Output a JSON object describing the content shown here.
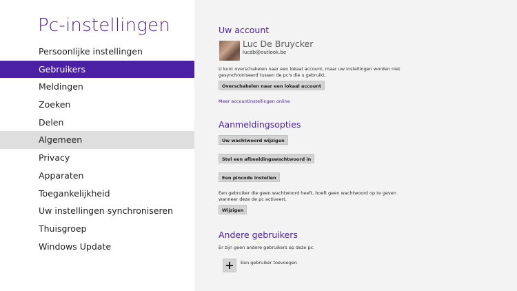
{
  "app": {
    "title": "Pc-instellingen"
  },
  "nav": {
    "items": [
      {
        "label": "Persoonlijke instellingen",
        "name": "nav-item-persoonlijke-instellingen",
        "state": "normal"
      },
      {
        "label": "Gebruikers",
        "name": "nav-item-gebruikers",
        "state": "selected"
      },
      {
        "label": "Meldingen",
        "name": "nav-item-meldingen",
        "state": "normal"
      },
      {
        "label": "Zoeken",
        "name": "nav-item-zoeken",
        "state": "normal"
      },
      {
        "label": "Delen",
        "name": "nav-item-delen",
        "state": "normal"
      },
      {
        "label": "Algemeen",
        "name": "nav-item-algemeen",
        "state": "hover"
      },
      {
        "label": "Privacy",
        "name": "nav-item-privacy",
        "state": "normal"
      },
      {
        "label": "Apparaten",
        "name": "nav-item-apparaten",
        "state": "normal"
      },
      {
        "label": "Toegankelijkheid",
        "name": "nav-item-toegankelijkheid",
        "state": "normal"
      },
      {
        "label": "Uw instellingen synchroniseren",
        "name": "nav-item-synchroniseren",
        "state": "normal"
      },
      {
        "label": "Thuisgroep",
        "name": "nav-item-thuisgroep",
        "state": "normal"
      },
      {
        "label": "Windows Update",
        "name": "nav-item-windows-update",
        "state": "normal"
      }
    ]
  },
  "account": {
    "title": "Uw account",
    "user_name": "Luc De Bruycker",
    "user_email": "lucdb@outlook.be",
    "description": "U kunt overschakelen naar een lokaal account, maar uw instellingen worden niet gesynchroniseerd tussen de pc's die u gebruikt.",
    "switch_button": "Overschakelen naar een lokaal account",
    "more_link": "Meer accountinstellingen online"
  },
  "signin": {
    "title": "Aanmeldingsopties",
    "change_password_button": "Uw wachtwoord wijzigen",
    "picture_password_button": "Stel een afbeeldingswachtwoord in",
    "pin_button": "Een pincode instellen",
    "description": "Een gebruiker die geen wachtwoord heeft, hoeft geen wachtwoord op te geven wanneer deze de pc activeert.",
    "change_button": "Wijzigen"
  },
  "other_users": {
    "title": "Andere gebruikers",
    "description": "Er zijn geen andere gebruikers op deze pc.",
    "add_label": "Een gebruiker toevoegen",
    "add_icon": "plus-icon"
  },
  "colors": {
    "accent": "#4c20a4",
    "panel": "#f3f3f3",
    "hover": "#dedede"
  }
}
